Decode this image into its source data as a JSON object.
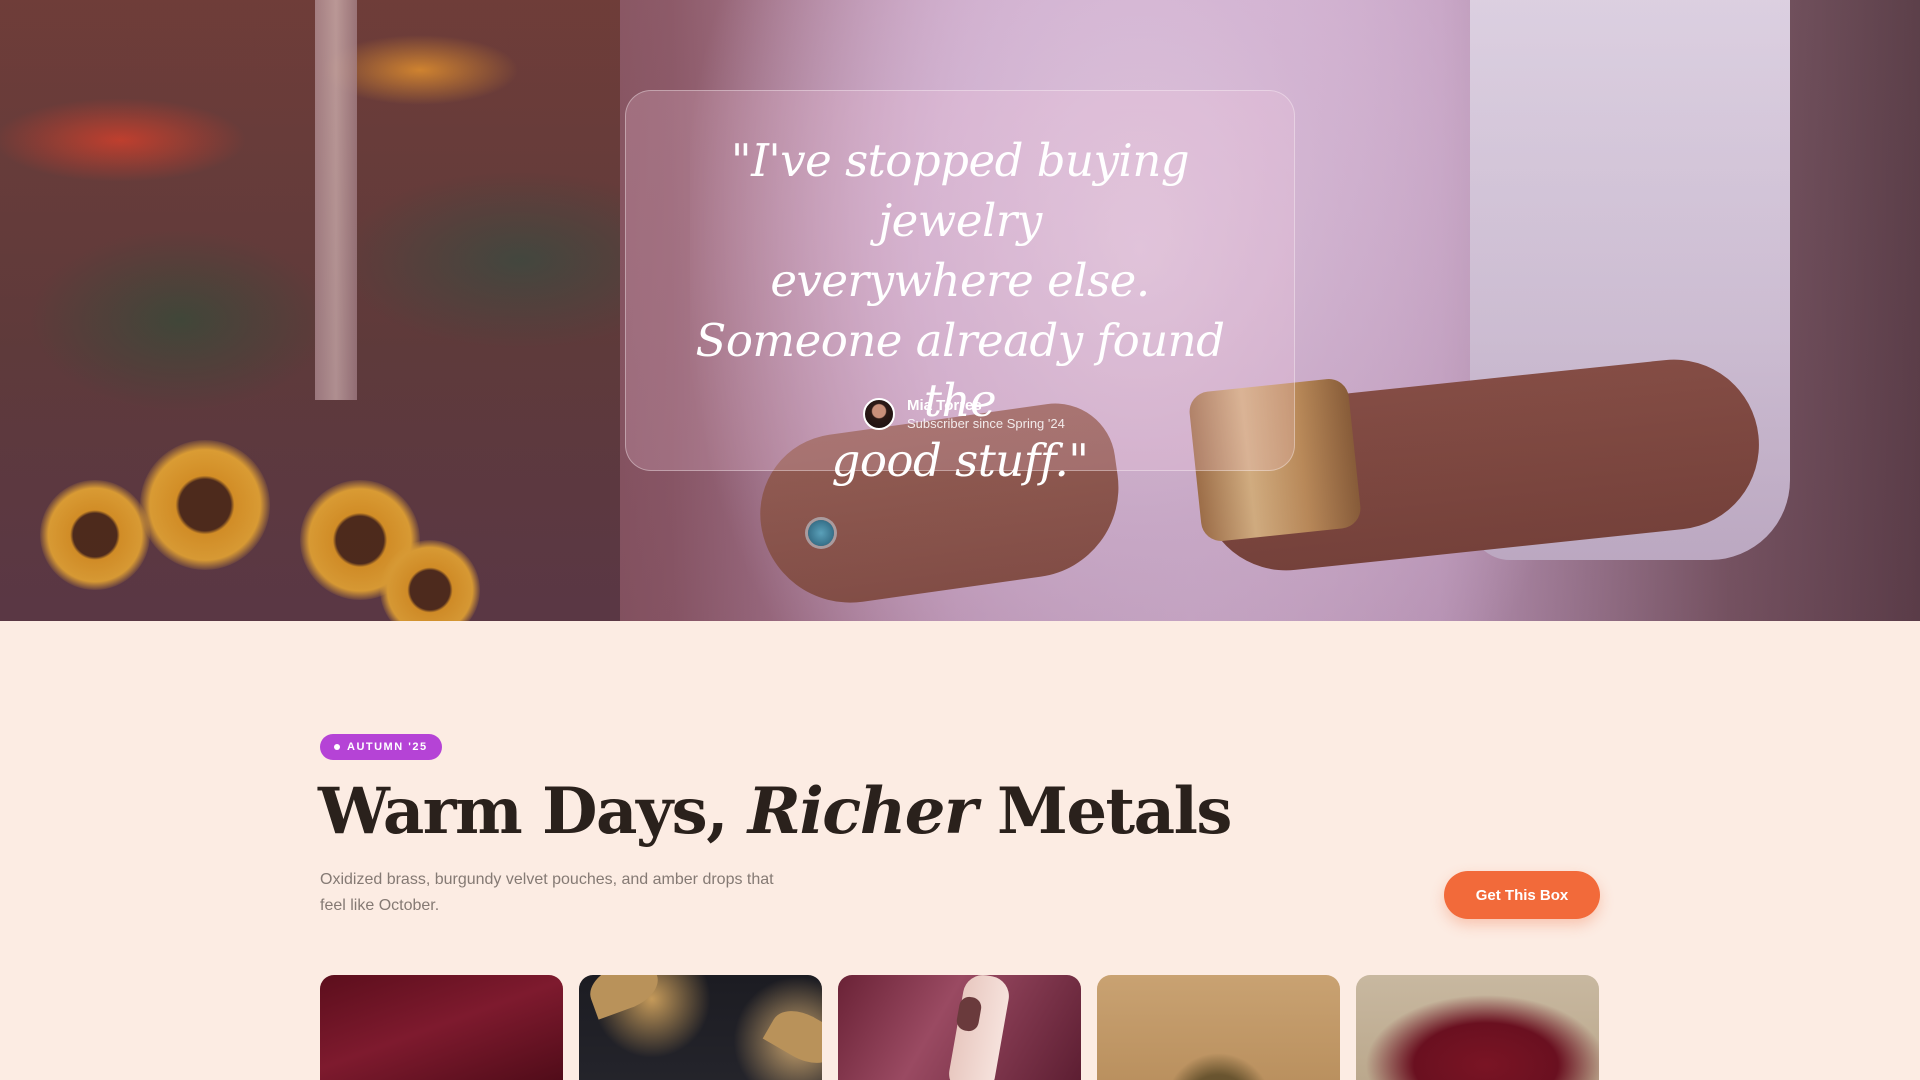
{
  "testimonial": {
    "quote": "\"I've stopped buying jewelry\neverywhere else.\nSomeone already found the\ngood stuff.\"",
    "author_name": "Mia Torres",
    "author_since": "Subscriber since Spring '24"
  },
  "collection": {
    "badge": "AUTUMN '25",
    "headline_start": "Warm Days, ",
    "headline_emphasis": "Richer",
    "headline_end": " Metals",
    "description": "Oxidized brass, burgundy velvet pouches, and amber drops that feel like October.",
    "cta_label": "Get This Box",
    "accent_color": "#b543d6",
    "cta_color": "#f26a3a"
  },
  "product_images": [
    "burgundy velvet",
    "silver earring on autumn leaves",
    "hand with brown nail polish",
    "gold chain on tan surface",
    "burgundy velvet pouch"
  ]
}
